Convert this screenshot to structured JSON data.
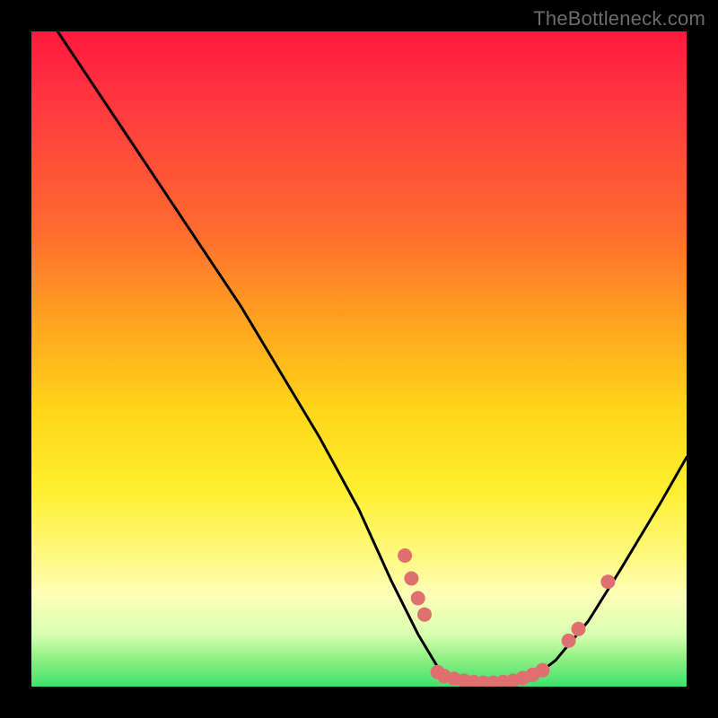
{
  "watermark": "TheBottleneck.com",
  "chart_data": {
    "type": "line",
    "title": "",
    "xlabel": "",
    "ylabel": "",
    "xlim": [
      0,
      100
    ],
    "ylim": [
      0,
      100
    ],
    "series": [
      {
        "name": "curve",
        "x": [
          4,
          8,
          14,
          20,
          26,
          32,
          38,
          44,
          50,
          55,
          59,
          62,
          65,
          68,
          72,
          76,
          80,
          85,
          90,
          96,
          100
        ],
        "y": [
          100,
          94,
          85,
          76,
          67,
          58,
          48,
          38,
          27,
          16,
          8,
          3,
          1,
          0,
          0,
          1,
          4,
          10,
          18,
          28,
          35
        ]
      }
    ],
    "markers": {
      "name": "highlight-dots",
      "color": "#e07070",
      "points": [
        {
          "x": 57,
          "y": 20
        },
        {
          "x": 58,
          "y": 16.5
        },
        {
          "x": 59,
          "y": 13.5
        },
        {
          "x": 60,
          "y": 11
        },
        {
          "x": 62,
          "y": 2.2
        },
        {
          "x": 63,
          "y": 1.6
        },
        {
          "x": 64.5,
          "y": 1.2
        },
        {
          "x": 66,
          "y": 0.9
        },
        {
          "x": 67.5,
          "y": 0.7
        },
        {
          "x": 69,
          "y": 0.6
        },
        {
          "x": 70.5,
          "y": 0.6
        },
        {
          "x": 72,
          "y": 0.7
        },
        {
          "x": 73.5,
          "y": 0.9
        },
        {
          "x": 75,
          "y": 1.3
        },
        {
          "x": 76.5,
          "y": 1.8
        },
        {
          "x": 78,
          "y": 2.5
        },
        {
          "x": 82,
          "y": 7
        },
        {
          "x": 83.5,
          "y": 8.8
        },
        {
          "x": 88,
          "y": 16
        }
      ]
    },
    "background_gradient": {
      "top": "#ff1a3f",
      "mid": "#ffd61a",
      "bottom": "#3fe26e"
    }
  }
}
